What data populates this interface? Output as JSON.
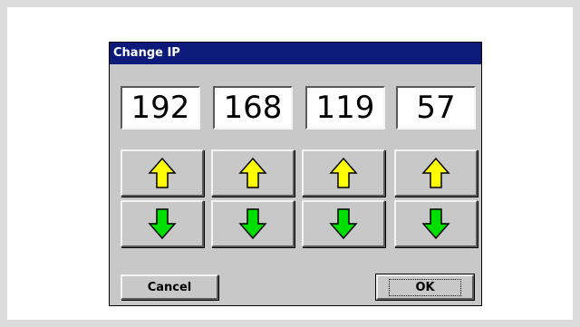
{
  "dialog": {
    "title": "Change IP",
    "octets": [
      "192",
      "168",
      "119",
      "57"
    ],
    "cancel_label": "Cancel",
    "ok_label": "OK"
  },
  "icons": {
    "increment": "arrow-up-icon",
    "decrement": "arrow-down-icon"
  },
  "colors": {
    "titlebar": "#0c1a7a",
    "up_arrow": "#ffff00",
    "down_arrow": "#00dd00"
  }
}
